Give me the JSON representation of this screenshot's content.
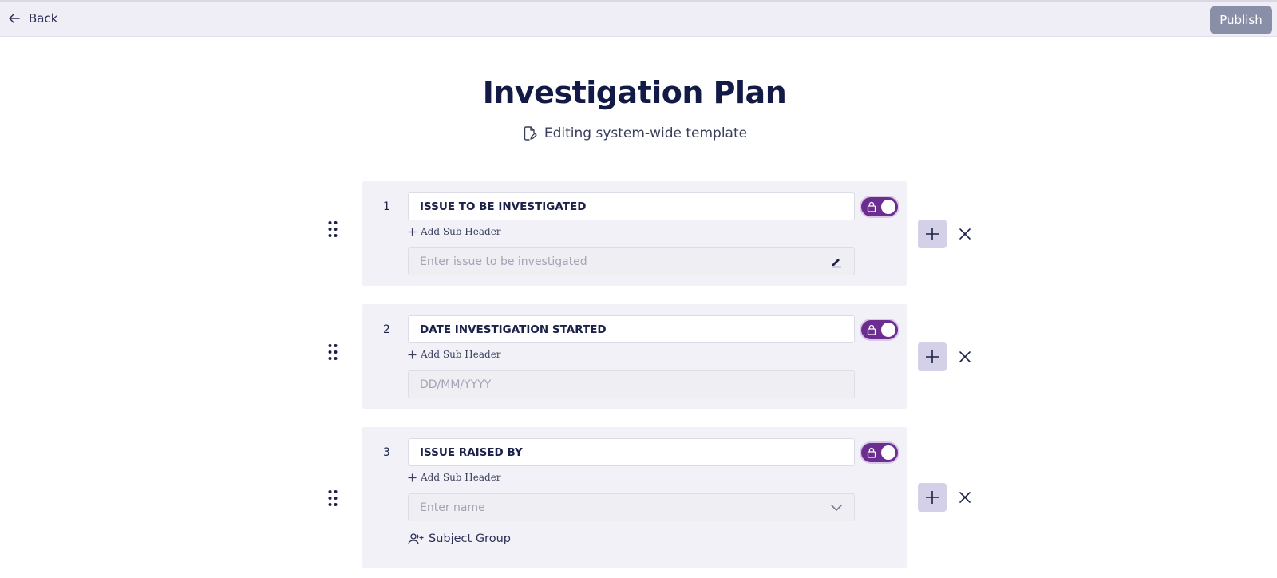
{
  "topbar": {
    "back_label": "Back",
    "publish_label": "Publish"
  },
  "page": {
    "title": "Investigation Plan",
    "subtitle": "Editing system-wide template"
  },
  "colors": {
    "accent": "#6b2d8f",
    "publish_bg": "#8a8fa8",
    "title": "#121a45",
    "card_bg": "#f1f1f7",
    "plus_bg": "#d4d0e8"
  },
  "sections": [
    {
      "number": "1",
      "header": "ISSUE TO BE INVESTIGATED",
      "add_sub_label": "Add Sub Header",
      "input_placeholder": "Enter issue to be investigated",
      "input_icon": "pencil-icon",
      "locked": true
    },
    {
      "number": "2",
      "header": "DATE INVESTIGATION STARTED",
      "add_sub_label": "Add Sub Header",
      "input_placeholder": "DD/MM/YYYY",
      "locked": true
    },
    {
      "number": "3",
      "header": "ISSUE RAISED BY",
      "add_sub_label": "Add Sub Header",
      "input_placeholder": "Enter name",
      "input_icon": "chevron-down-icon",
      "extra_label": "Subject Group",
      "locked": true
    }
  ]
}
